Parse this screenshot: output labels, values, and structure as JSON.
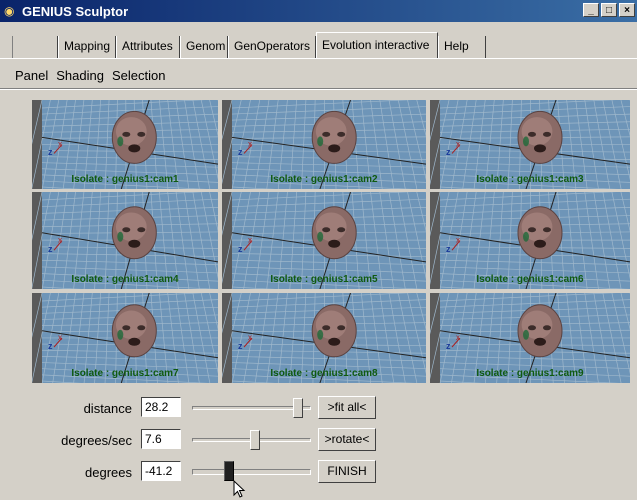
{
  "window": {
    "title": "GENIUS Sculptor",
    "icon": "app-logo-icon",
    "buttons": [
      "minimize",
      "maximize",
      "close"
    ]
  },
  "tabs": [
    {
      "label": ""
    },
    {
      "label": "Mapping"
    },
    {
      "label": "Attributes"
    },
    {
      "label": "Genom"
    },
    {
      "label": "GenOperators"
    },
    {
      "label": "Evolution interactive",
      "active": true
    },
    {
      "label": "Help"
    }
  ],
  "menu": [
    "Panel",
    "Shading",
    "Selection"
  ],
  "viewports": [
    {
      "label": "Isolate : genius1:cam1"
    },
    {
      "label": "Isolate : genius1:cam2"
    },
    {
      "label": "Isolate : genius1:cam3"
    },
    {
      "label": "Isolate : genius1:cam4"
    },
    {
      "label": "Isolate : genius1:cam5"
    },
    {
      "label": "Isolate : genius1:cam6"
    },
    {
      "label": "Isolate : genius1:cam7"
    },
    {
      "label": "Isolate : genius1:cam8"
    },
    {
      "label": "Isolate : genius1:cam9"
    }
  ],
  "controls": [
    {
      "label": "distance",
      "value": "28.2",
      "slider_fraction": 0.92,
      "button": ">fit all<"
    },
    {
      "label": "degrees/sec",
      "value": "7.6",
      "slider_fraction": 0.52,
      "button": ">rotate<"
    },
    {
      "label": "degrees",
      "value": "-41.2",
      "slider_fraction": 0.28,
      "button": "FINISH"
    }
  ],
  "colors": {
    "titlebar": "#0a246a",
    "window_bg": "#d4d0c8",
    "viewport_bg": "#6e95b8",
    "label_green": "#0f5a0f"
  }
}
